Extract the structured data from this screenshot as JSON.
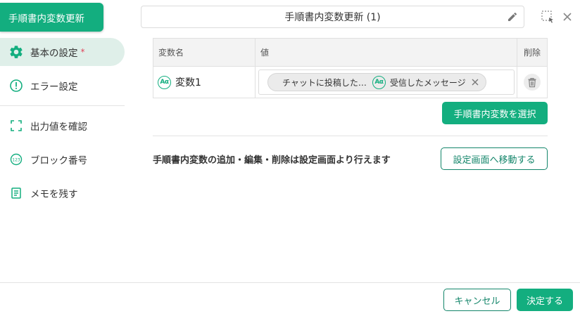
{
  "sidebar": {
    "app_tab": "手順書内変数更新",
    "items": [
      {
        "label": "基本の設定",
        "required": "*",
        "icon": "gear-icon"
      },
      {
        "label": "エラー設定",
        "icon": "alert-circle-icon"
      },
      {
        "label": "出力値を確認",
        "icon": "frame-corners-icon"
      },
      {
        "label": "ブロック番号",
        "icon": "number-badge-icon"
      },
      {
        "label": "メモを残す",
        "icon": "notes-icon"
      }
    ]
  },
  "header": {
    "title": "手順書内変数更新 (1)"
  },
  "table": {
    "columns": [
      "変数名",
      "値",
      "削除"
    ],
    "rows": [
      {
        "variable_name": "変数1",
        "chips": [
          {
            "text": "チャットに投稿した…"
          },
          {
            "text": "受信したメッセージ",
            "badge": "Aα"
          }
        ]
      }
    ],
    "name_badge": "Aα"
  },
  "buttons": {
    "select_variable": "手順書内変数を選択",
    "go_settings": "設定画面へ移動する",
    "cancel": "キャンセル",
    "confirm": "決定する"
  },
  "note": "手順書内変数の追加・編集・削除は設定画面より行えます",
  "colors": {
    "accent": "#13ae7f",
    "active_bg": "#dfefe9",
    "required": "#e0445b"
  }
}
